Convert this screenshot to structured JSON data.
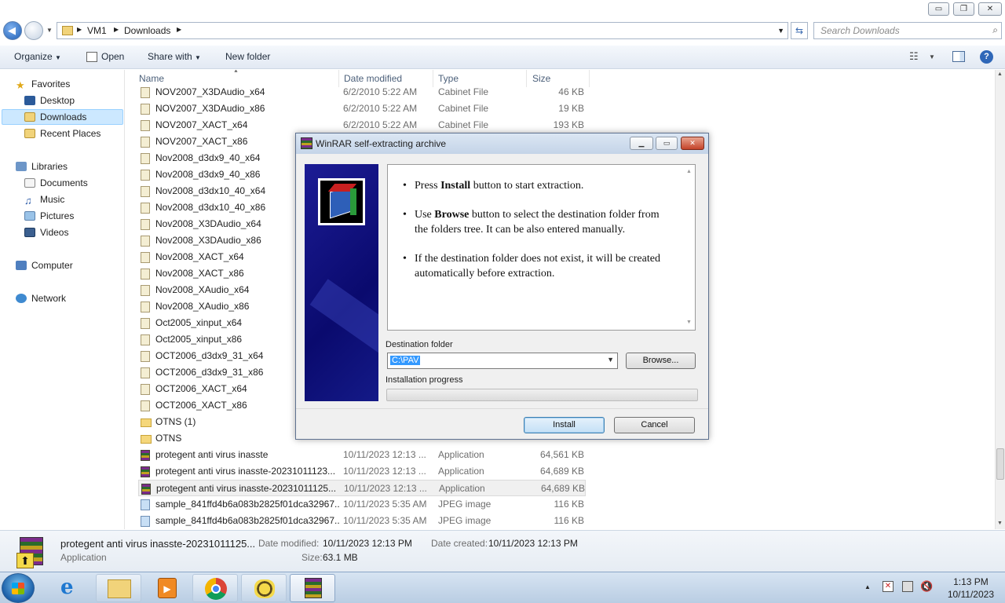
{
  "window": {
    "minimize": "▭",
    "maximize": "❐",
    "close": "✕"
  },
  "address": {
    "crumbs": [
      "VM1",
      "Downloads"
    ],
    "search_placeholder": "Search Downloads"
  },
  "toolbar": {
    "organize": "Organize",
    "open": "Open",
    "share_with": "Share with",
    "new_folder": "New folder"
  },
  "nav": {
    "favorites": "Favorites",
    "desktop": "Desktop",
    "downloads": "Downloads",
    "recent_places": "Recent Places",
    "libraries": "Libraries",
    "documents": "Documents",
    "music": "Music",
    "pictures": "Pictures",
    "videos": "Videos",
    "computer": "Computer",
    "network": "Network"
  },
  "columns": {
    "name": "Name",
    "date_modified": "Date modified",
    "type": "Type",
    "size": "Size"
  },
  "files": [
    {
      "name": "NOV2007_X3DAudio_x64",
      "date": "6/2/2010 5:22 AM",
      "type": "Cabinet File",
      "size": "46 KB",
      "icon": "cab"
    },
    {
      "name": "NOV2007_X3DAudio_x86",
      "date": "6/2/2010 5:22 AM",
      "type": "Cabinet File",
      "size": "19 KB",
      "icon": "cab"
    },
    {
      "name": "NOV2007_XACT_x64",
      "date": "6/2/2010 5:22 AM",
      "type": "Cabinet File",
      "size": "193 KB",
      "icon": "cab"
    },
    {
      "name": "NOV2007_XACT_x86",
      "date": "",
      "type": "",
      "size": "",
      "icon": "cab"
    },
    {
      "name": "Nov2008_d3dx9_40_x64",
      "date": "",
      "type": "",
      "size": "",
      "icon": "cab"
    },
    {
      "name": "Nov2008_d3dx9_40_x86",
      "date": "",
      "type": "",
      "size": "",
      "icon": "cab"
    },
    {
      "name": "Nov2008_d3dx10_40_x64",
      "date": "",
      "type": "",
      "size": "",
      "icon": "cab"
    },
    {
      "name": "Nov2008_d3dx10_40_x86",
      "date": "",
      "type": "",
      "size": "",
      "icon": "cab"
    },
    {
      "name": "Nov2008_X3DAudio_x64",
      "date": "",
      "type": "",
      "size": "",
      "icon": "cab"
    },
    {
      "name": "Nov2008_X3DAudio_x86",
      "date": "",
      "type": "",
      "size": "",
      "icon": "cab"
    },
    {
      "name": "Nov2008_XACT_x64",
      "date": "",
      "type": "",
      "size": "",
      "icon": "cab"
    },
    {
      "name": "Nov2008_XACT_x86",
      "date": "",
      "type": "",
      "size": "",
      "icon": "cab"
    },
    {
      "name": "Nov2008_XAudio_x64",
      "date": "",
      "type": "",
      "size": "",
      "icon": "cab"
    },
    {
      "name": "Nov2008_XAudio_x86",
      "date": "",
      "type": "",
      "size": "",
      "icon": "cab"
    },
    {
      "name": "Oct2005_xinput_x64",
      "date": "",
      "type": "",
      "size": "",
      "icon": "cab"
    },
    {
      "name": "Oct2005_xinput_x86",
      "date": "",
      "type": "",
      "size": "",
      "icon": "cab"
    },
    {
      "name": "OCT2006_d3dx9_31_x64",
      "date": "",
      "type": "",
      "size": "",
      "icon": "cab"
    },
    {
      "name": "OCT2006_d3dx9_31_x86",
      "date": "",
      "type": "",
      "size": "",
      "icon": "cab"
    },
    {
      "name": "OCT2006_XACT_x64",
      "date": "",
      "type": "",
      "size": "",
      "icon": "cab"
    },
    {
      "name": "OCT2006_XACT_x86",
      "date": "",
      "type": "",
      "size": "",
      "icon": "cab"
    },
    {
      "name": "OTNS (1)",
      "date": "",
      "type": "",
      "size": "",
      "icon": "folder"
    },
    {
      "name": "OTNS",
      "date": "",
      "type": "",
      "size": "",
      "icon": "folder"
    },
    {
      "name": "protegent anti virus inasste",
      "date": "10/11/2023 12:13 ...",
      "type": "Application",
      "size": "64,561 KB",
      "icon": "app"
    },
    {
      "name": "protegent anti virus inasste-20231011123...",
      "date": "10/11/2023 12:13 ...",
      "type": "Application",
      "size": "64,689 KB",
      "icon": "app"
    },
    {
      "name": "protegent anti virus inasste-20231011125...",
      "date": "10/11/2023 12:13 ...",
      "type": "Application",
      "size": "64,689 KB",
      "icon": "app",
      "selected": true
    },
    {
      "name": "sample_841ffd4b6a083b2825f01dca32967...",
      "date": "10/11/2023 5:35 AM",
      "type": "JPEG image",
      "size": "116 KB",
      "icon": "img"
    },
    {
      "name": "sample_841ffd4b6a083b2825f01dca32967...",
      "date": "10/11/2023 5:35 AM",
      "type": "JPEG image",
      "size": "116 KB",
      "icon": "img"
    }
  ],
  "details": {
    "name": "protegent anti virus inasste-20231011125...",
    "type": "Application",
    "date_modified_label": "Date modified:",
    "date_modified": "10/11/2023 12:13 PM",
    "date_created_label": "Date created:",
    "date_created": "10/11/2023 12:13 PM",
    "size_label": "Size:",
    "size": "63.1 MB"
  },
  "dialog": {
    "title": "WinRAR self-extracting archive",
    "bullets": [
      {
        "pre": "Press ",
        "bold": "Install",
        "post": " button to start extraction."
      },
      {
        "pre": "Use ",
        "bold": "Browse",
        "post": " button to select the destination folder from the folders tree. It can be also entered manually."
      },
      {
        "pre": "",
        "bold": "",
        "post": "If the destination folder does not exist, it will be created automatically before extraction."
      }
    ],
    "destination_label": "Destination folder",
    "destination_value": "C:\\PAV",
    "browse": "Browse...",
    "progress_label": "Installation progress",
    "progress": 0,
    "install": "Install",
    "cancel": "Cancel"
  },
  "clock": {
    "time": "1:13 PM",
    "date": "10/11/2023"
  }
}
